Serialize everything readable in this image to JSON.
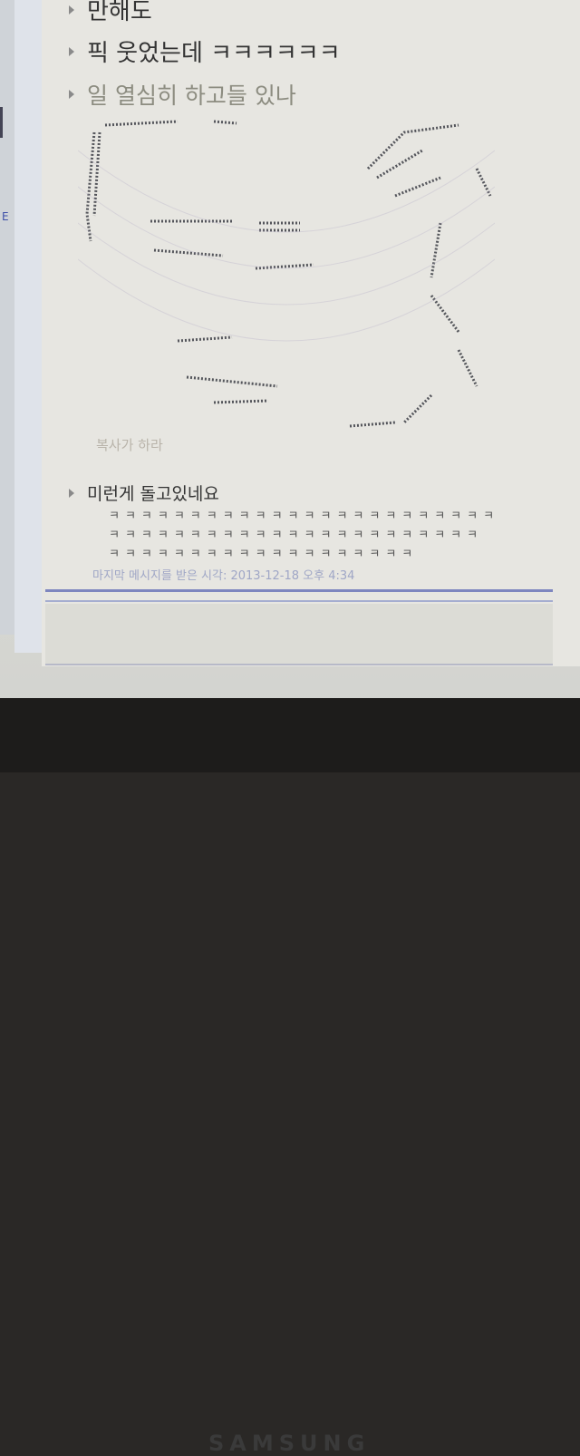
{
  "colors": {
    "background": "#e7e6e1",
    "text": "#333333",
    "muted": "#8c8c80",
    "accent": "#7e86bf"
  },
  "left_strip": {
    "mark": "E"
  },
  "messages": [
    {
      "text": "만해도"
    },
    {
      "text": "픽 웃었는데 ㅋㅋㅋㅋㅋㅋ"
    },
    {
      "text": "일 열심히 하고들 있나"
    },
    {
      "text": "미런게 돌고있네요"
    }
  ],
  "image_caption": "복사가 하라",
  "laughter_lines": [
    "ㅋㅋㅋㅋㅋㅋㅋㅋㅋㅋㅋㅋㅋㅋㅋㅋㅋㅋㅋㅋㅋㅋㅋㅋ",
    "ㅋㅋㅋㅋㅋㅋㅋㅋㅋㅋㅋㅋㅋㅋㅋㅋㅋㅋㅋㅋㅋㅋㅋ",
    "ㅋㅋㅋㅋㅋㅋㅋㅋㅋㅋㅋㅋㅋㅋㅋㅋㅋㅋㅋ"
  ],
  "last_message_time": "마지막 메시지를 받은 시각: 2013-12-18 오후 4:34",
  "monitor_brand": "SAMSUNG"
}
